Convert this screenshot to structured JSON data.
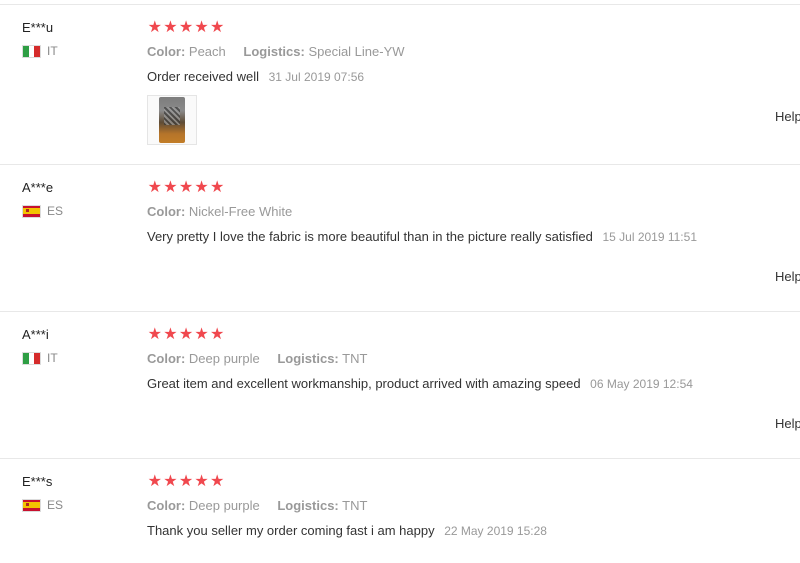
{
  "reviews": [
    {
      "user": "E***u",
      "country_code": "IT",
      "country_flag": "italy-flag",
      "rating": 5,
      "stars": [
        "★",
        "★",
        "★",
        "★",
        "★"
      ],
      "color_label": "Color:",
      "color_value": "Peach",
      "logistics_label": "Logistics:",
      "logistics_value": "Special Line-YW",
      "feedback": "Order received well",
      "date": "31 Jul 2019 07:56",
      "has_photo": true,
      "helpful_label": "Help"
    },
    {
      "user": "A***e",
      "country_code": "ES",
      "country_flag": "spain-flag",
      "rating": 5,
      "stars": [
        "★",
        "★",
        "★",
        "★",
        "★"
      ],
      "color_label": "Color:",
      "color_value": "Nickel-Free White",
      "feedback": "Very pretty I love the fabric is more beautiful than in the picture really satisfied",
      "date": "15 Jul 2019 11:51",
      "has_photo": false,
      "helpful_label": "Help"
    },
    {
      "user": "A***i",
      "country_code": "IT",
      "country_flag": "italy-flag",
      "rating": 5,
      "stars": [
        "★",
        "★",
        "★",
        "★",
        "★"
      ],
      "color_label": "Color:",
      "color_value": "Deep purple",
      "logistics_label": "Logistics:",
      "logistics_value": "TNT",
      "feedback": "Great item and excellent workmanship, product arrived with amazing speed",
      "date": "06 May 2019 12:54",
      "has_photo": false,
      "helpful_label": "Help"
    },
    {
      "user": "E***s",
      "country_code": "ES",
      "country_flag": "spain-flag",
      "rating": 5,
      "stars": [
        "★",
        "★",
        "★",
        "★",
        "★"
      ],
      "color_label": "Color:",
      "color_value": "Deep purple",
      "logistics_label": "Logistics:",
      "logistics_value": "TNT",
      "feedback": "Thank you seller my order coming fast i am happy",
      "date": "22 May 2019 15:28",
      "has_photo": false
    }
  ],
  "colors": {
    "star": "#f0484e",
    "muted_text": "#999999",
    "body_text": "#333333",
    "divider": "#e8e8e8"
  }
}
